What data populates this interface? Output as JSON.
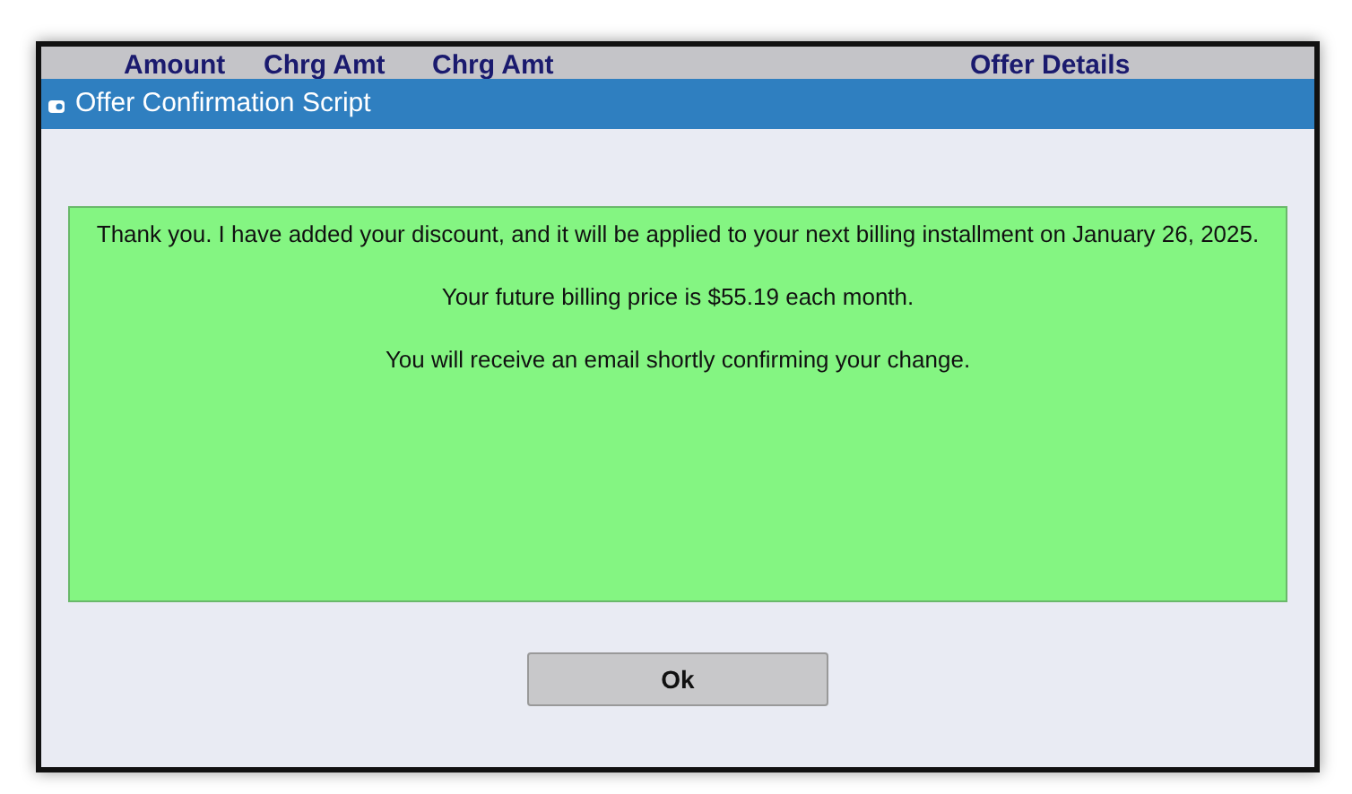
{
  "background_table": {
    "columns": [
      "Amount",
      "Chrg Amt",
      "Chrg Amt",
      "Offer Details"
    ]
  },
  "dialog": {
    "title": "Offer Confirmation Script",
    "paragraphs": [
      "Thank you. I have added your discount, and it will be applied to your next billing installment on January 26, 2025.",
      "Your future billing price is $55.19 each month.",
      "You will receive an email shortly confirming your change."
    ],
    "buttons": [
      "Ok"
    ]
  }
}
